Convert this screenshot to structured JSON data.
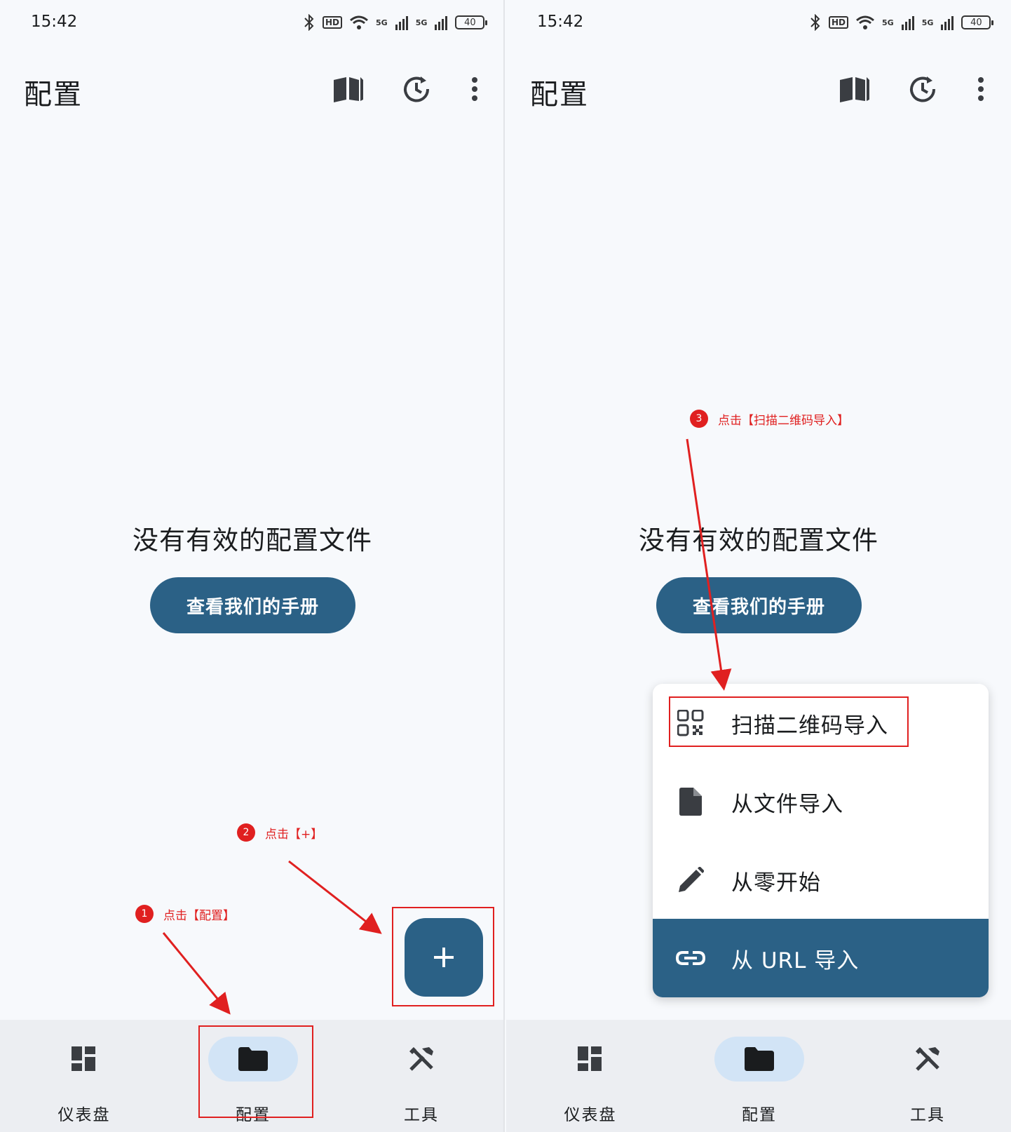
{
  "status_bar": {
    "time": "15:42",
    "battery": "40",
    "hd": "HD",
    "sig1": "5G",
    "sig2": "5G"
  },
  "app_bar": {
    "title": "配置"
  },
  "empty_state": {
    "title": "没有有效的配置文件",
    "button": "查看我们的手册"
  },
  "bottom_nav": {
    "items": [
      {
        "label": "仪表盘",
        "icon": "dashboard-icon",
        "active": false
      },
      {
        "label": "配置",
        "icon": "folder-icon",
        "active": true
      },
      {
        "label": "工具",
        "icon": "tools-icon",
        "active": false
      }
    ]
  },
  "menu": {
    "items": [
      {
        "label": "扫描二维码导入",
        "icon": "qr-code-icon"
      },
      {
        "label": "从文件导入",
        "icon": "file-icon"
      },
      {
        "label": "从零开始",
        "icon": "pencil-icon"
      },
      {
        "label": "从 URL 导入",
        "icon": "link-icon",
        "active": true
      }
    ]
  },
  "annotations": {
    "step1": {
      "num": "1",
      "text": "点击【配置】"
    },
    "step2": {
      "num": "2",
      "text": "点击【+】"
    },
    "step3": {
      "num": "3",
      "text": "点击【扫描二维码导入】"
    }
  },
  "colors": {
    "primary": "#2b6186",
    "annotation": "#e02020",
    "nav_active": "#d2e4f6",
    "background": "#f7f9fc"
  }
}
